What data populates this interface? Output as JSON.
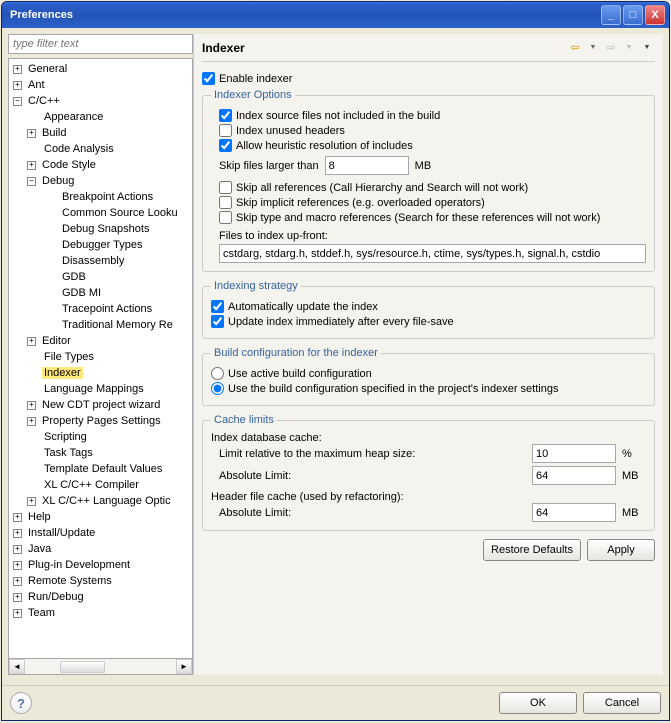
{
  "window": {
    "title": "Preferences"
  },
  "filter": {
    "placeholder": "type filter text"
  },
  "tree": {
    "general": "General",
    "ant": "Ant",
    "ccpp": "C/C++",
    "appearance": "Appearance",
    "build": "Build",
    "code_analysis": "Code Analysis",
    "code_style": "Code Style",
    "debug": "Debug",
    "breakpoint_actions": "Breakpoint Actions",
    "common_source": "Common Source Looku",
    "debug_snapshots": "Debug Snapshots",
    "debugger_types": "Debugger Types",
    "disassembly": "Disassembly",
    "gdb": "GDB",
    "gdb_mi": "GDB MI",
    "tracepoint_actions": "Tracepoint Actions",
    "traditional_memory": "Traditional Memory Re",
    "editor": "Editor",
    "file_types": "File Types",
    "indexer": "Indexer",
    "language_mappings": "Language Mappings",
    "new_cdt": "New CDT project wizard",
    "property_pages": "Property Pages Settings",
    "scripting": "Scripting",
    "task_tags": "Task Tags",
    "template_defaults": "Template Default Values",
    "xl_compiler": "XL C/C++ Compiler",
    "xl_lang": "XL C/C++ Language Optic",
    "help": "Help",
    "install": "Install/Update",
    "java": "Java",
    "plugin_dev": "Plug-in Development",
    "remote": "Remote Systems",
    "run_debug": "Run/Debug",
    "team": "Team"
  },
  "page": {
    "title": "Indexer",
    "enable": "Enable indexer",
    "options_legend": "Indexer Options",
    "opt_index_not_in_build": "Index source files not included in the build",
    "opt_index_unused": "Index unused headers",
    "opt_heuristic": "Allow heuristic resolution of includes",
    "skip_larger_label": "Skip files larger than",
    "skip_larger_value": "8",
    "skip_larger_unit": "MB",
    "opt_skip_all_refs": "Skip all references (Call Hierarchy and Search will not work)",
    "opt_skip_implicit": "Skip implicit references (e.g. overloaded operators)",
    "opt_skip_type_macro": "Skip type and macro references (Search for these references will not work)",
    "files_upfront_label": "Files to index up-front:",
    "files_upfront_value": "cstdarg, stdarg.h, stddef.h, sys/resource.h, ctime, sys/types.h, signal.h, cstdio",
    "strategy_legend": "Indexing strategy",
    "strat_auto_update": "Automatically update the index",
    "strat_on_save": "Update index immediately after every file-save",
    "buildcfg_legend": "Build configuration for the indexer",
    "buildcfg_active": "Use active build configuration",
    "buildcfg_specified": "Use the build configuration specified in the project's indexer settings",
    "cache_legend": "Cache limits",
    "cache_db_label": "Index database cache:",
    "cache_rel_label": "Limit relative to the maximum heap size:",
    "cache_rel_value": "10",
    "cache_rel_unit": "%",
    "cache_abs_label": "Absolute Limit:",
    "cache_abs_value": "64",
    "cache_abs_unit": "MB",
    "cache_header_label": "Header file cache (used by refactoring):",
    "cache_header_abs_label": "Absolute Limit:",
    "cache_header_abs_value": "64",
    "cache_header_abs_unit": "MB",
    "restore_defaults": "Restore Defaults",
    "apply": "Apply",
    "ok": "OK",
    "cancel": "Cancel"
  }
}
